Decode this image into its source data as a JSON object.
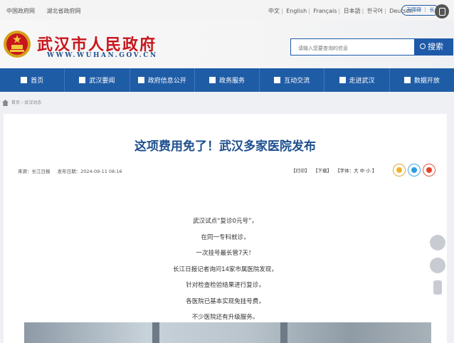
{
  "topbar": {
    "links": [
      "中国政府网",
      "湖北省政府网"
    ],
    "languages": [
      "中文",
      "English",
      "Français",
      "日本語",
      "한국어",
      "Deutsch"
    ],
    "barrier_free": "无障碍 ｜ 长"
  },
  "header": {
    "title": "武汉市人民政府",
    "url": "WWW.WUHAN.GOV.CN",
    "search_placeholder": "请输入您要查询的信息",
    "search_button": "搜索"
  },
  "nav": {
    "items": [
      "首页",
      "武汉要闻",
      "政府信息公开",
      "政务服务",
      "互动交流",
      "走进武汉",
      "数据开放"
    ]
  },
  "breadcrumb": {
    "home": "首页",
    "sep": "›",
    "current": "武汉动态"
  },
  "article": {
    "title": "这项费用免了！武汉多家医院发布",
    "source": "来源：长江日报",
    "date": "发布日期：2024-09-11 08:16",
    "print": "【打印】",
    "download": "【下载】",
    "font_size": "【字体：大 中 小 】",
    "paragraphs": [
      "武汉试点“复诊0元号”，",
      "在同一专科就诊，",
      "一次挂号最长管7天！",
      "长江日报记者询问14家市属医院发现，",
      "针对检查检验结果进行复诊，",
      "各医院已基本实现免挂号费，",
      "不少医院还有升级服务。"
    ]
  },
  "colors": {
    "brand_blue": "#1f5ca6",
    "title_red": "#c8161d",
    "article_title_blue": "#1e4f8f"
  },
  "icons": {
    "nav": [
      "home-icon",
      "news-icon",
      "info-disclosure-icon",
      "service-icon",
      "interaction-icon",
      "visit-icon",
      "data-icon"
    ],
    "share": [
      "qzone-icon",
      "qq-icon",
      "weibo-icon"
    ],
    "float": [
      "wechat-icon",
      "weibo-icon",
      "mobile-icon"
    ]
  }
}
